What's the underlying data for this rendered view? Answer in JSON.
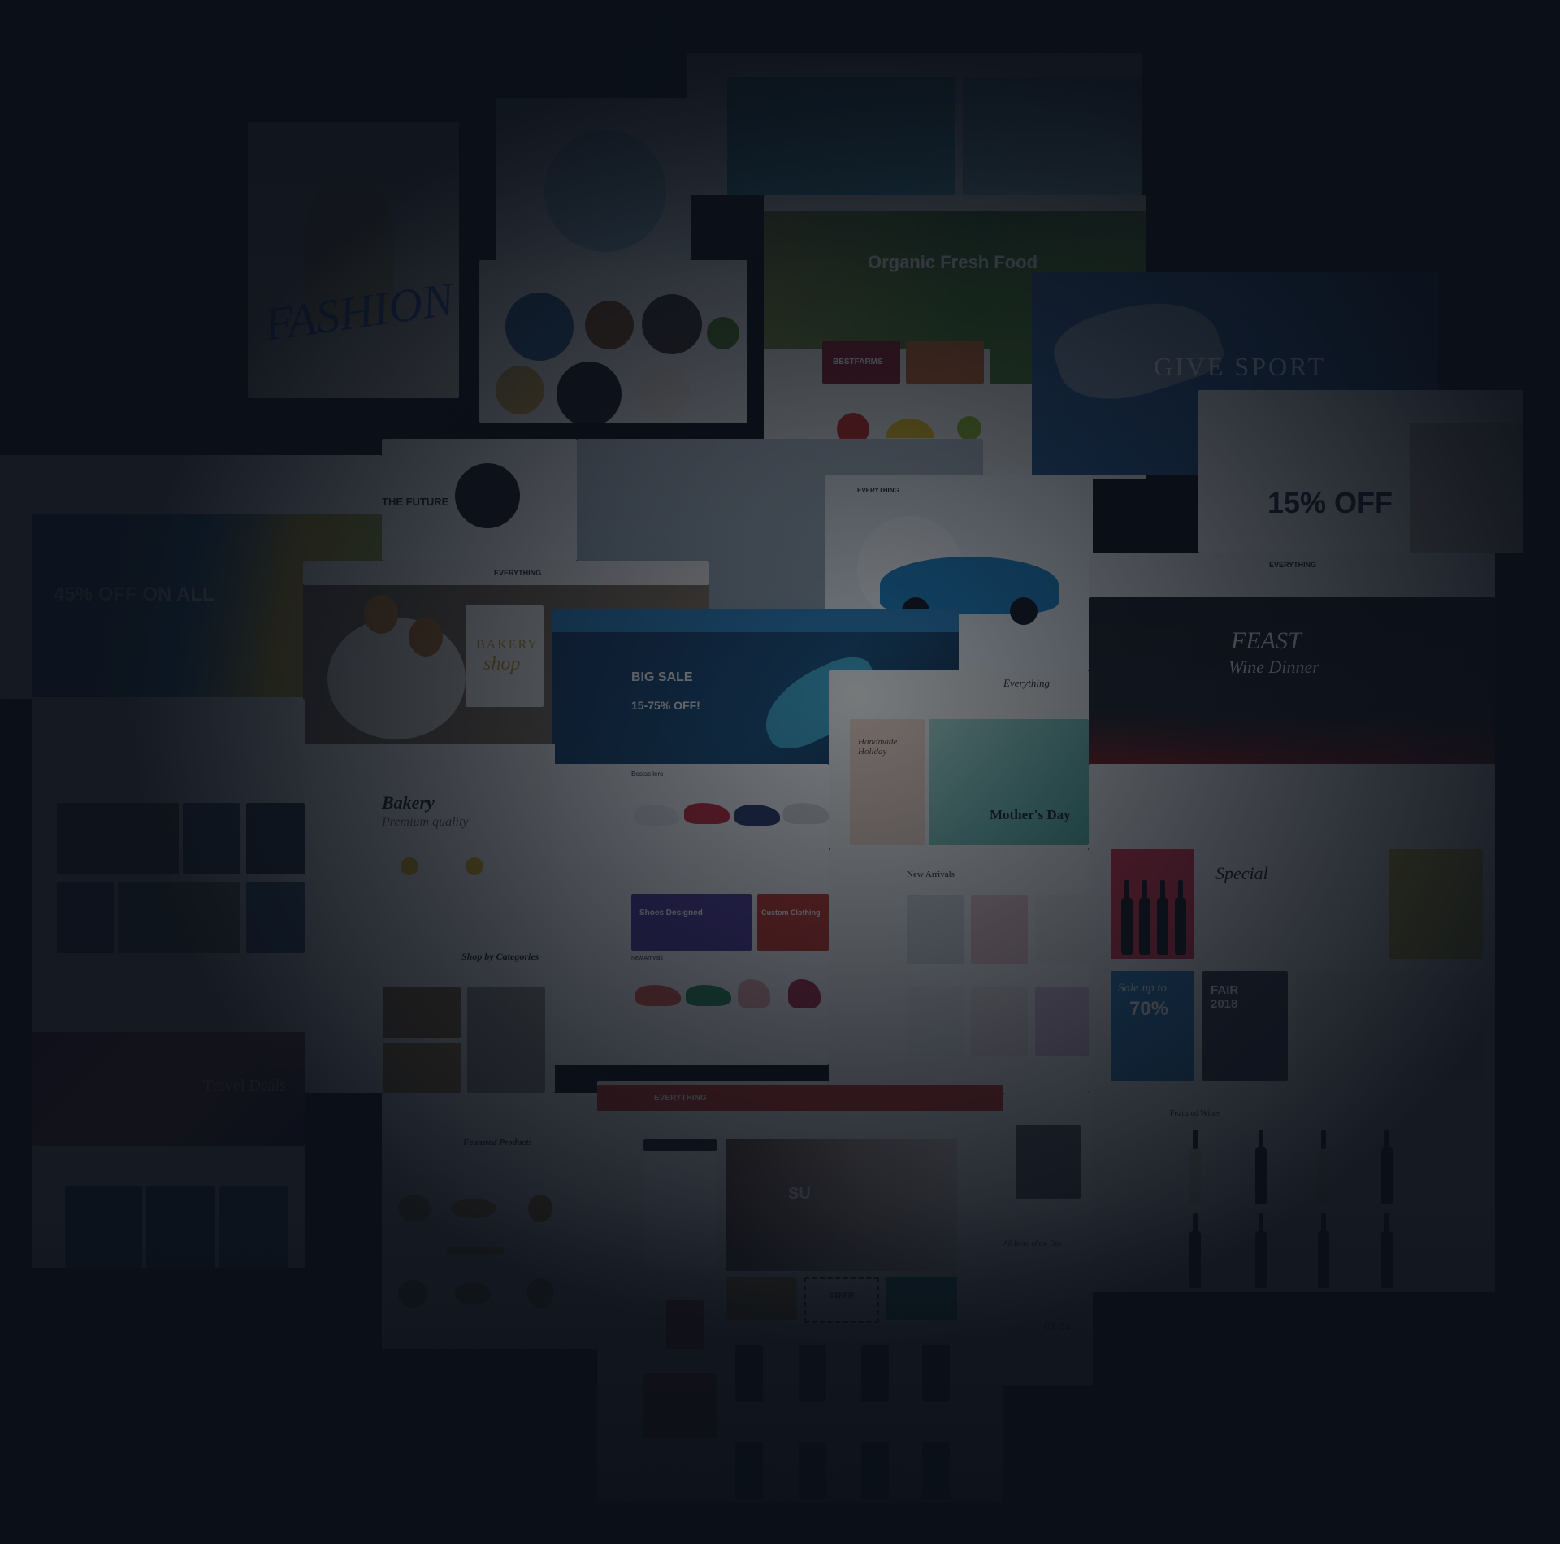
{
  "texts": {
    "fashion": "FASHION",
    "organic": "Organic Fresh Food",
    "bestfarms": "BESTFARMS",
    "give_sport": "GIVE SPORT",
    "fifteen_off": "15% OFF",
    "everything": "EVERYTHING",
    "everything_script": "Everything",
    "off_all": "45% OFF ON ALL",
    "future": "THE FUTURE",
    "bakery_shop_1": "BAKERY",
    "bakery_shop_2": "shop",
    "big_sale": "BIG SALE",
    "big_sale_pct": "15-75% OFF!",
    "feast": "FEAST",
    "wine_dinner": "Wine Dinner",
    "handmade": "Handmade Holiday",
    "mothers_day": "Mother's Day",
    "new_arrivals": "New Arrivals",
    "bakery": "Bakery",
    "premium": "Premium quality",
    "shop_by_categories": "Shop by Categories",
    "featured_products": "Featured Products",
    "travel_deals": "Travel Deals",
    "shoes_designed": "Shoes Designed",
    "custom_clothing": "Custom Clothing",
    "new_arrivals_small": "New Arrivals",
    "bestsellers": "Bestsellers",
    "special": "Special",
    "sale_up_to": "Sale up to",
    "seventy": "70%",
    "fair": "FAIR 2018",
    "featured_wines": "Featured Wines",
    "free": "FREE",
    "sale_banner": "SU",
    "all_items": "All Items of the Day",
    "countdown": "01  04"
  },
  "colors": {
    "background": "#0a0f18",
    "accent_blue": "#2a86c4",
    "accent_red": "#c8362a",
    "accent_yellow": "#e0b21a",
    "accent_teal": "#1b8a7a",
    "accent_purple": "#4f3a9a"
  }
}
